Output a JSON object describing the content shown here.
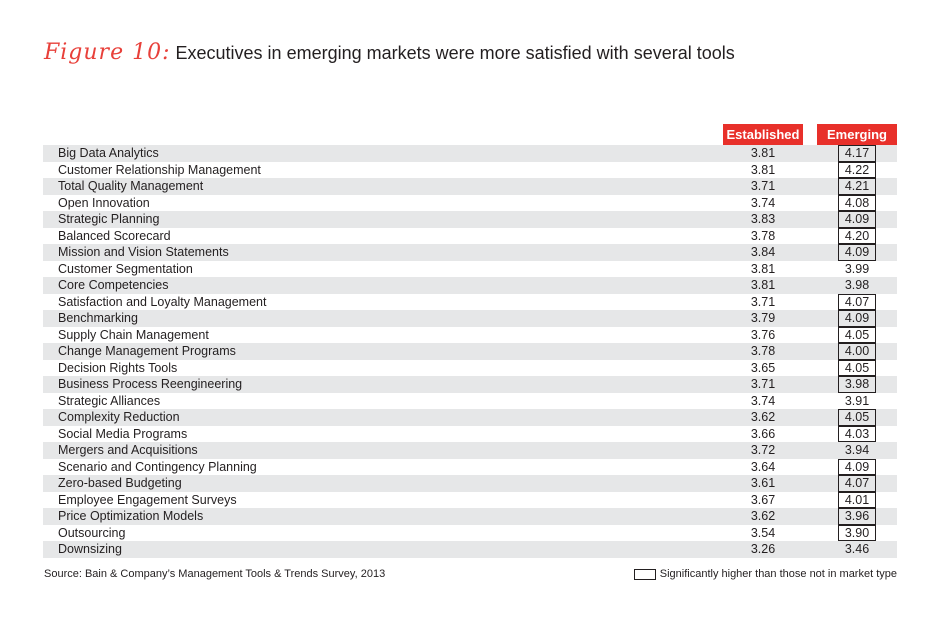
{
  "title": {
    "figure": "Figure 10:",
    "text": "Executives in emerging markets were more satisfied with several tools"
  },
  "chart_data": {
    "type": "table",
    "columns": [
      "Established",
      "Emerging"
    ],
    "rows": [
      {
        "tool": "Big Data Analytics",
        "established": 3.81,
        "emerging": 4.17,
        "significant": true
      },
      {
        "tool": "Customer Relationship Management",
        "established": 3.81,
        "emerging": 4.22,
        "significant": true
      },
      {
        "tool": "Total Quality Management",
        "established": 3.71,
        "emerging": 4.21,
        "significant": true
      },
      {
        "tool": "Open Innovation",
        "established": 3.74,
        "emerging": 4.08,
        "significant": true
      },
      {
        "tool": "Strategic Planning",
        "established": 3.83,
        "emerging": 4.09,
        "significant": true
      },
      {
        "tool": "Balanced Scorecard",
        "established": 3.78,
        "emerging": 4.2,
        "significant": true
      },
      {
        "tool": "Mission and Vision Statements",
        "established": 3.84,
        "emerging": 4.09,
        "significant": true
      },
      {
        "tool": "Customer Segmentation",
        "established": 3.81,
        "emerging": 3.99,
        "significant": false
      },
      {
        "tool": "Core Competencies",
        "established": 3.81,
        "emerging": 3.98,
        "significant": false
      },
      {
        "tool": "Satisfaction and Loyalty Management",
        "established": 3.71,
        "emerging": 4.07,
        "significant": true
      },
      {
        "tool": "Benchmarking",
        "established": 3.79,
        "emerging": 4.09,
        "significant": true
      },
      {
        "tool": "Supply Chain Management",
        "established": 3.76,
        "emerging": 4.05,
        "significant": true
      },
      {
        "tool": "Change Management Programs",
        "established": 3.78,
        "emerging": 4.0,
        "significant": true
      },
      {
        "tool": "Decision Rights Tools",
        "established": 3.65,
        "emerging": 4.05,
        "significant": true
      },
      {
        "tool": "Business Process Reengineering",
        "established": 3.71,
        "emerging": 3.98,
        "significant": true
      },
      {
        "tool": "Strategic Alliances",
        "established": 3.74,
        "emerging": 3.91,
        "significant": false
      },
      {
        "tool": "Complexity Reduction",
        "established": 3.62,
        "emerging": 4.05,
        "significant": true
      },
      {
        "tool": "Social Media Programs",
        "established": 3.66,
        "emerging": 4.03,
        "significant": true
      },
      {
        "tool": "Mergers and Acquisitions",
        "established": 3.72,
        "emerging": 3.94,
        "significant": false
      },
      {
        "tool": "Scenario and Contingency Planning",
        "established": 3.64,
        "emerging": 4.09,
        "significant": true
      },
      {
        "tool": "Zero-based Budgeting",
        "established": 3.61,
        "emerging": 4.07,
        "significant": true
      },
      {
        "tool": "Employee Engagement Surveys",
        "established": 3.67,
        "emerging": 4.01,
        "significant": true
      },
      {
        "tool": "Price Optimization Models",
        "established": 3.62,
        "emerging": 3.96,
        "significant": true
      },
      {
        "tool": "Outsourcing",
        "established": 3.54,
        "emerging": 3.9,
        "significant": true
      },
      {
        "tool": "Downsizing",
        "established": 3.26,
        "emerging": 3.46,
        "significant": false
      }
    ]
  },
  "colors": {
    "header": "#e8302a",
    "stripe": "#e6e7e8",
    "figure_label": "#e8403a"
  },
  "source": "Source: Bain & Company’s Management Tools & Trends Survey, 2013",
  "legend": "Significantly higher than those not in market type"
}
